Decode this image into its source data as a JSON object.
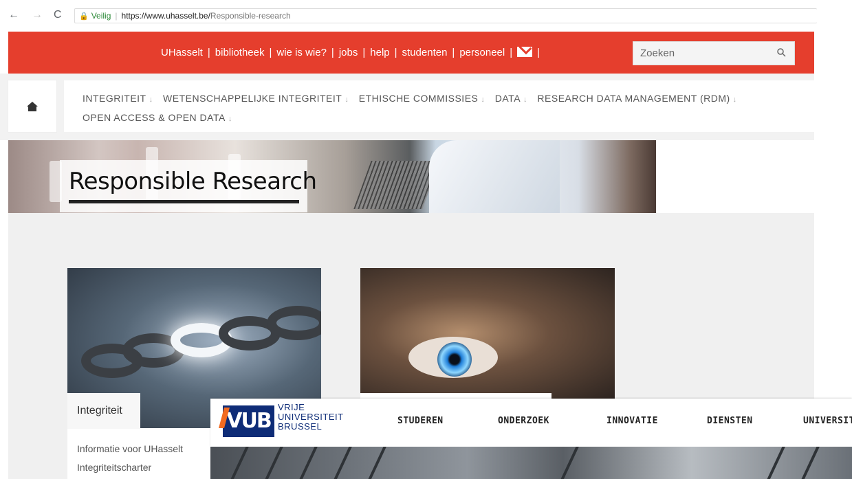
{
  "browser": {
    "back_label": "←",
    "forward_label": "→",
    "reload_label": "C",
    "secure_label": "Veilig",
    "url_host": "https://www.uhasselt.be/",
    "url_path": "Responsible-research"
  },
  "topbar": {
    "links": [
      "UHasselt",
      "bibliotheek",
      "wie is wie?",
      "jobs",
      "help",
      "studenten",
      "personeel"
    ],
    "search_placeholder": "Zoeken",
    "accent_color": "#e53e2d"
  },
  "secondary_nav": {
    "row1": [
      "INTEGRITEIT",
      "WETENSCHAPPELIJKE INTEGRITEIT",
      "ETHISCHE COMMISSIES",
      "DATA",
      "RESEARCH DATA MANAGEMENT (RDM)"
    ],
    "row2": [
      "OPEN ACCESS & OPEN DATA"
    ]
  },
  "hero": {
    "title": "Responsible Research"
  },
  "cards": [
    {
      "label": "Integriteit",
      "description_line1": "Informatie voor UHasselt",
      "description_line2": "Integriteitscharter"
    },
    {
      "label": ""
    }
  ],
  "vub": {
    "logo": "VUB",
    "name_line1": "VRIJE",
    "name_line2": "UNIVERSITEIT",
    "name_line3": "BRUSSEL",
    "nav": [
      "STUDEREN",
      "ONDERZOEK",
      "INNOVATIE",
      "DIENSTEN",
      "UNIVERSIT"
    ],
    "brand_color": "#0e2c77",
    "accent_color": "#f26b21"
  }
}
